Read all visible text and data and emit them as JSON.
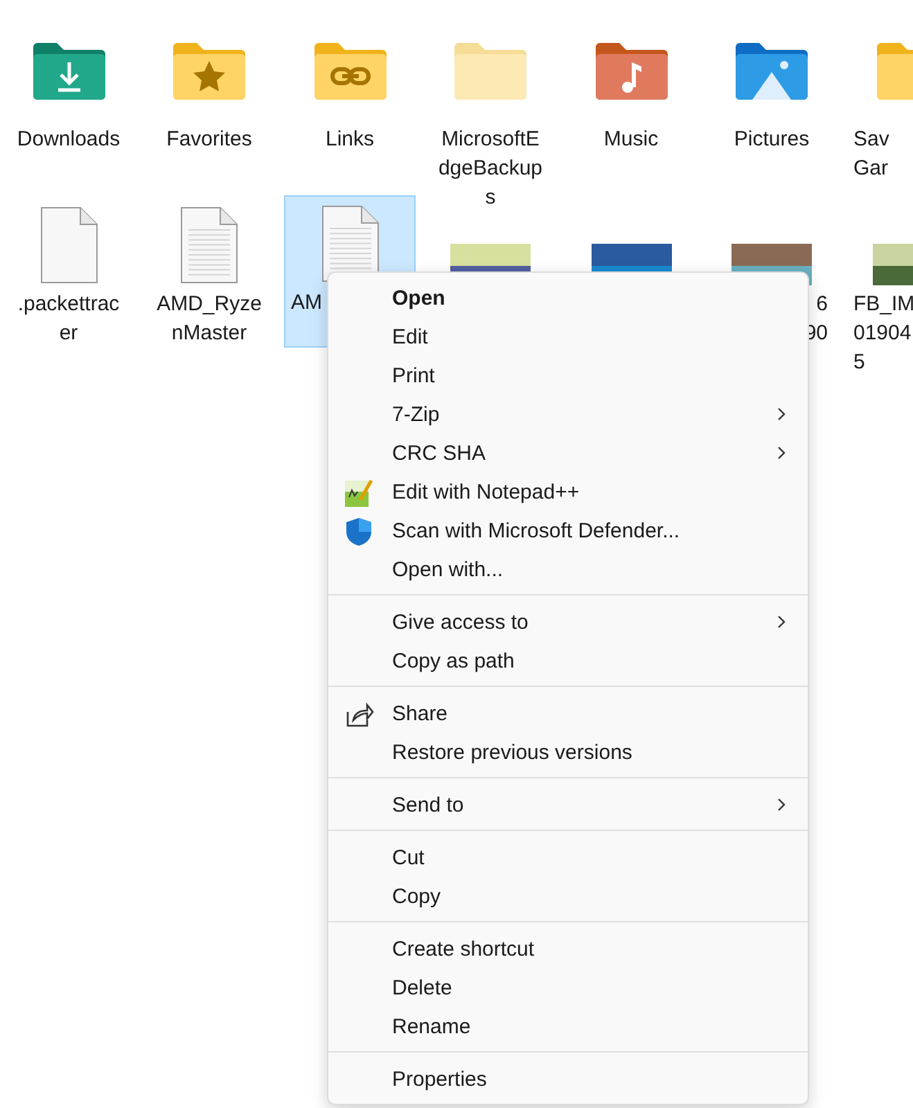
{
  "items": [
    {
      "kind": "folder",
      "label": [
        "Downloads"
      ],
      "selected": false
    },
    {
      "kind": "folder",
      "label": [
        "Favorites"
      ],
      "selected": false
    },
    {
      "kind": "folder",
      "label": [
        "Links"
      ],
      "selected": false
    },
    {
      "kind": "folder",
      "label": [
        "MicrosoftE",
        "dgeBackup",
        "s"
      ],
      "selected": false
    },
    {
      "kind": "folder",
      "label": [
        "Music"
      ],
      "selected": false
    },
    {
      "kind": "folder",
      "label": [
        "Pictures"
      ],
      "selected": false
    },
    {
      "kind": "folder",
      "label": [
        "Sav",
        "Gar"
      ],
      "selected": false
    },
    {
      "kind": "file",
      "label": [
        ".packettrac",
        "er"
      ],
      "selected": false
    },
    {
      "kind": "text",
      "label": [
        "AMD_Ryze",
        "nMaster"
      ],
      "selected": false
    },
    {
      "kind": "text",
      "label": [
        "AM"
      ],
      "selected": true
    },
    {
      "kind": "photo",
      "selected": false
    },
    {
      "kind": "photo",
      "selected": false
    },
    {
      "kind": "photo",
      "label": [
        "6",
        "90"
      ],
      "selected": false
    },
    {
      "kind": "photo",
      "label": [
        "FB_IM",
        "01904",
        "5"
      ],
      "selected": false
    }
  ],
  "menu": {
    "sections": [
      [
        {
          "label": "Open",
          "default": true,
          "submenu": false
        },
        {
          "label": "Edit",
          "default": false,
          "submenu": false
        },
        {
          "label": "Print",
          "default": false,
          "submenu": false
        },
        {
          "label": "7-Zip",
          "default": false,
          "submenu": true
        },
        {
          "label": "CRC SHA",
          "default": false,
          "submenu": true
        },
        {
          "label": "Edit with Notepad++",
          "default": false,
          "submenu": false
        },
        {
          "label": "Scan with Microsoft Defender...",
          "default": false,
          "submenu": false
        },
        {
          "label": "Open with...",
          "default": false,
          "submenu": false
        }
      ],
      [
        {
          "label": "Give access to",
          "default": false,
          "submenu": true
        },
        {
          "label": "Copy as path",
          "default": false,
          "submenu": false
        }
      ],
      [
        {
          "label": "Share",
          "default": false,
          "submenu": false
        },
        {
          "label": "Restore previous versions",
          "default": false,
          "submenu": false
        }
      ],
      [
        {
          "label": "Send to",
          "default": false,
          "submenu": true
        }
      ],
      [
        {
          "label": "Cut",
          "default": false,
          "submenu": false
        },
        {
          "label": "Copy",
          "default": false,
          "submenu": false
        }
      ],
      [
        {
          "label": "Create shortcut",
          "default": false,
          "submenu": false
        },
        {
          "label": "Delete",
          "default": false,
          "submenu": false
        },
        {
          "label": "Rename",
          "default": false,
          "submenu": false
        }
      ],
      [
        {
          "label": "Properties",
          "default": false,
          "submenu": false
        }
      ]
    ]
  }
}
